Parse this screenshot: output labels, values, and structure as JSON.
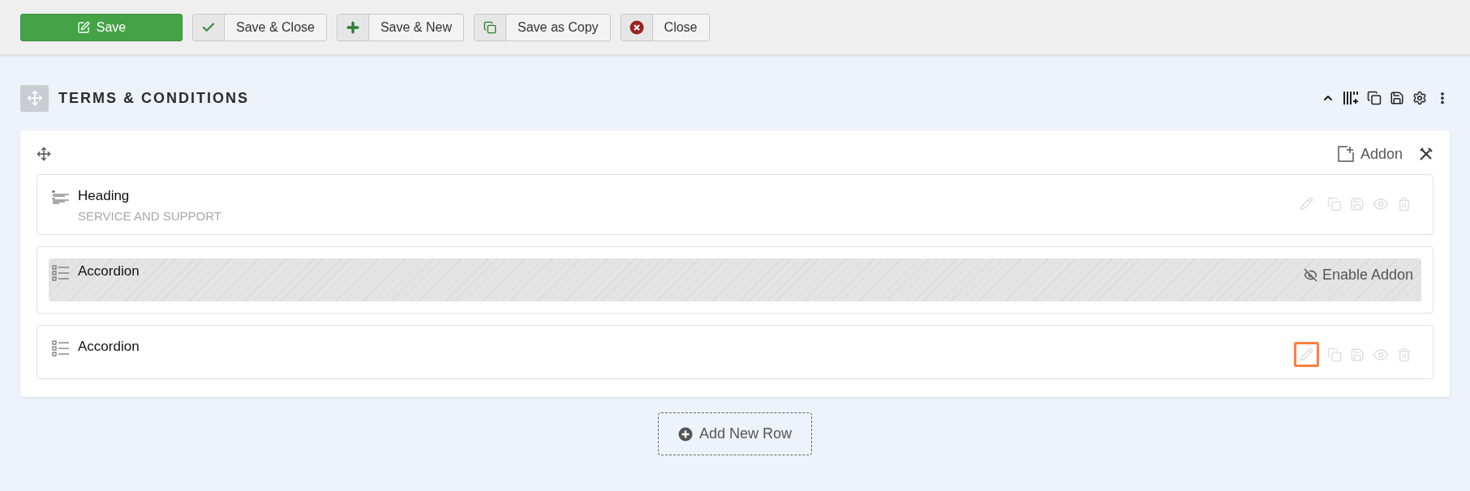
{
  "toolbar": [
    {
      "kind": "primary",
      "label": "Save"
    },
    {
      "kind": "check",
      "label": "Save & Close"
    },
    {
      "kind": "plus",
      "label": "Save & New"
    },
    {
      "kind": "copy",
      "label": "Save as Copy"
    },
    {
      "kind": "close",
      "label": "Close"
    }
  ],
  "section": {
    "title": "TERMS & CONDITIONS",
    "expanded": true,
    "addon_button": "Addon",
    "addons": [
      {
        "kind": "heading",
        "title": "Heading",
        "subtitle": "SERVICE AND SUPPORT",
        "disabled": false,
        "highlighted": false
      },
      {
        "kind": "accordion",
        "title": "Accordion",
        "disabled": true,
        "enable_label": "Enable Addon"
      },
      {
        "kind": "accordion",
        "title": "Accordion",
        "disabled": false,
        "highlighted": true
      }
    ]
  },
  "add_row": "Add New Row"
}
